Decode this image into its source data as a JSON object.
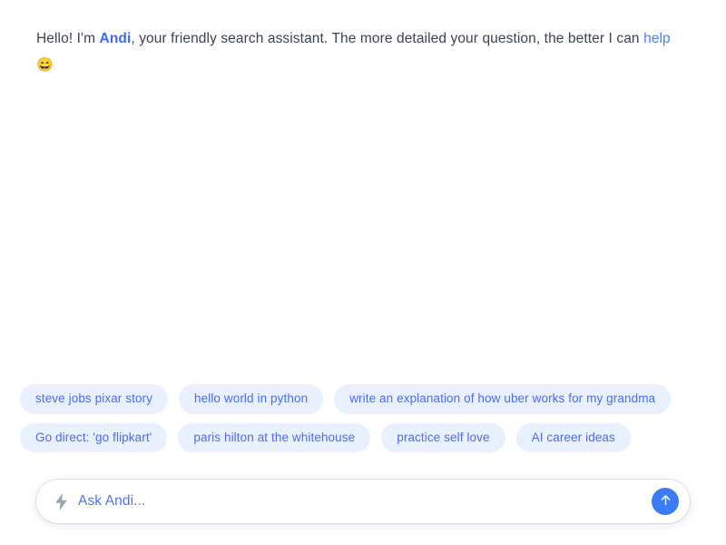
{
  "greeting": {
    "part1": "Hello! I'm ",
    "brand": "Andi",
    "part2": ", your friendly search assistant. The more detailed your question, the better I can ",
    "help_label": "help",
    "emoji": "😄"
  },
  "suggestions": {
    "chips": [
      {
        "label": "steve jobs pixar story"
      },
      {
        "label": "hello world in python"
      },
      {
        "label": "write an explanation of how uber works for my grandma"
      },
      {
        "label": "Go direct: 'go flipkart'"
      },
      {
        "label": "paris hilton at the whitehouse"
      },
      {
        "label": "practice self love"
      },
      {
        "label": "AI career ideas"
      }
    ]
  },
  "search": {
    "placeholder": "Ask Andi...",
    "value": "",
    "bolt_icon": "lightning-bolt-icon",
    "send_icon": "arrow-up-icon"
  },
  "colors": {
    "brand_blue": "#3b6bf5",
    "chip_bg": "#e9f0fe",
    "chip_text": "#4a6df3",
    "send_button_bg": "#3b7bf6",
    "body_text": "#3c4257",
    "bolt_gray": "#9aa2af",
    "page_bg": "#ffffff"
  }
}
